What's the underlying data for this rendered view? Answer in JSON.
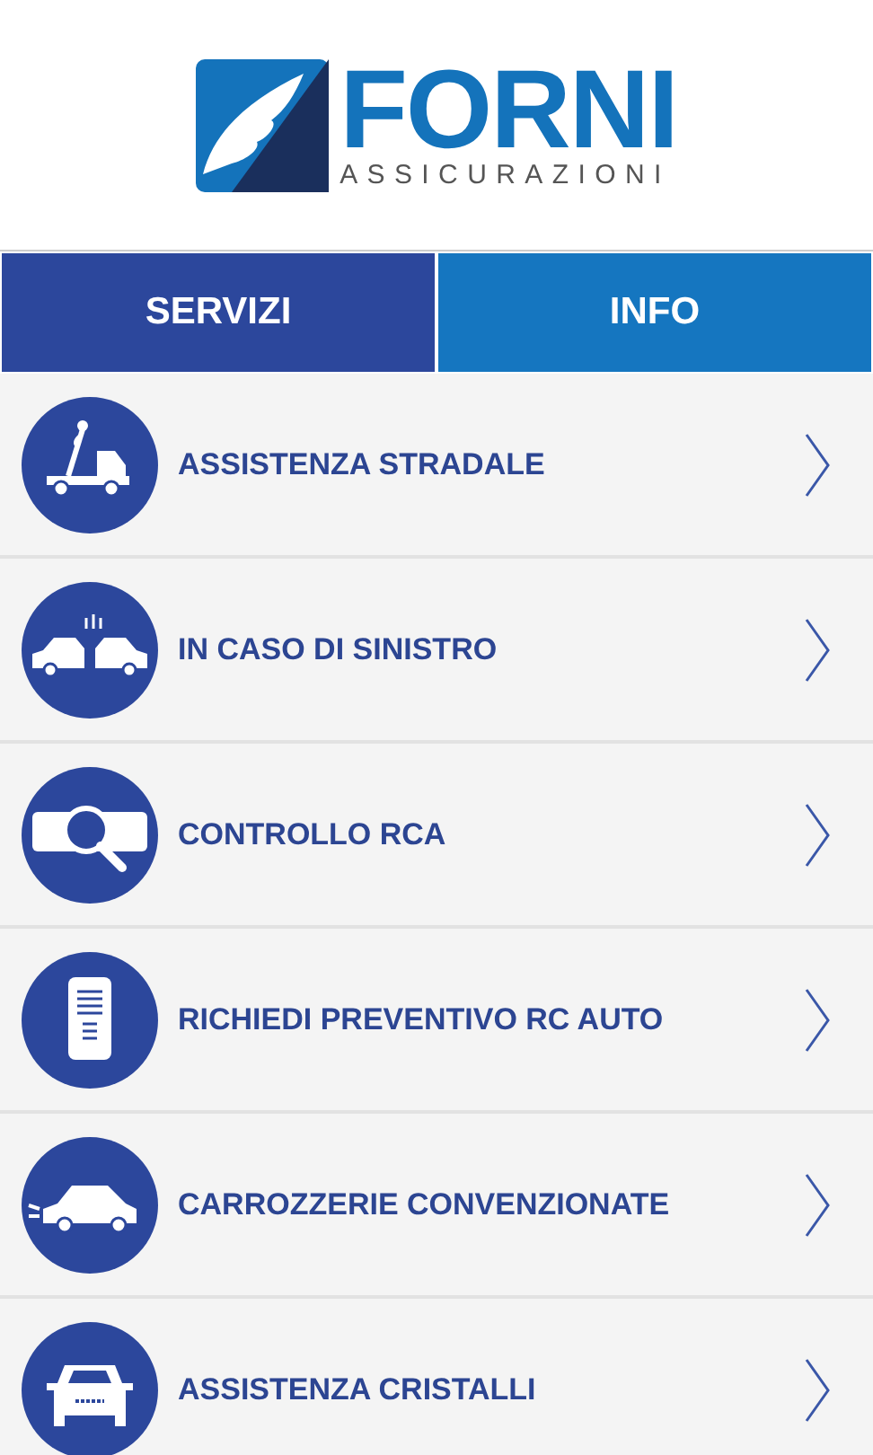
{
  "logo": {
    "name": "FORNI",
    "tagline": "ASSICURAZIONI"
  },
  "tabs": [
    {
      "label": "SERVIZI",
      "selected": true
    },
    {
      "label": "INFO",
      "selected": false
    }
  ],
  "services": [
    {
      "label": "ASSISTENZA STRADALE",
      "kind": "tow"
    },
    {
      "label": "IN CASO DI SINISTRO",
      "kind": "crash"
    },
    {
      "label": "CONTROLLO RCA",
      "kind": "plate"
    },
    {
      "label": "RICHIEDI PREVENTIVO RC AUTO",
      "kind": "document"
    },
    {
      "label": "CARROZZERIE CONVENZIONATE",
      "kind": "car"
    },
    {
      "label": "ASSISTENZA CRISTALLI",
      "kind": "windshield"
    }
  ]
}
